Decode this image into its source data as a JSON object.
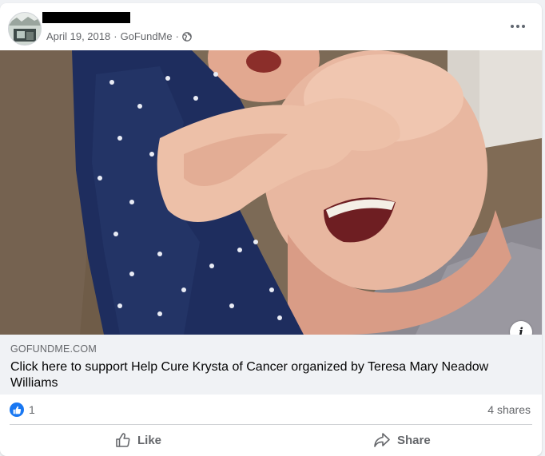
{
  "post": {
    "date": "April 19, 2018",
    "separator": "·",
    "source": "GoFundMe",
    "audience_icon": "globe-icon",
    "more_icon": "more-options-icon"
  },
  "link": {
    "domain": "GOFUNDME.COM",
    "title": "Click here to support Help Cure Krysta of Cancer organized by Teresa Mary Neadow Williams",
    "info_icon_glyph": "i"
  },
  "engagement": {
    "reaction_icon": "like-reaction-icon",
    "reaction_count": "1",
    "shares": "4 shares"
  },
  "actions": {
    "like_label": "Like",
    "share_label": "Share"
  },
  "colors": {
    "accent": "#1877f2",
    "secondary_text": "#65676b",
    "link_box_bg": "#f0f2f5"
  }
}
